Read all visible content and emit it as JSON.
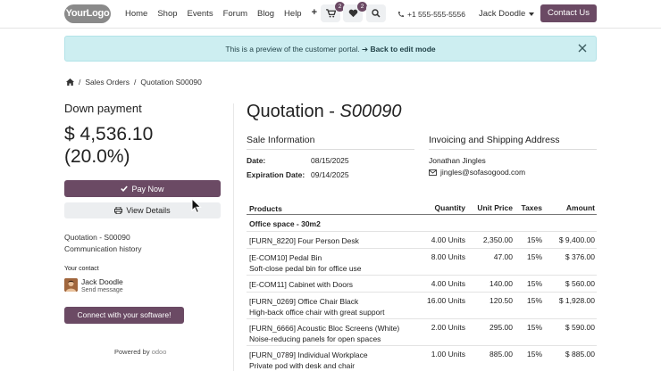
{
  "header": {
    "logo_text": "YourLogo",
    "nav": [
      "Home",
      "Shop",
      "Events",
      "Forum",
      "Blog",
      "Help"
    ],
    "cart_count": "2",
    "wishlist_count": "2",
    "phone": "+1 555-555-5556",
    "user_name": "Jack Doodle",
    "contact_label": "Contact Us"
  },
  "banner": {
    "text": "This is a preview of the customer portal.",
    "link": "Back to edit mode"
  },
  "breadcrumb": {
    "sales_orders": "Sales Orders",
    "current": "Quotation S00090"
  },
  "sidebar": {
    "down_payment_label": "Down payment",
    "amount": "$ 4,536.10",
    "percent": "(20.0%)",
    "pay_now": "Pay Now",
    "view_details": "View Details",
    "link_quotation": "Quotation - S00090",
    "link_history": "Communication history",
    "your_contact_label": "Your contact",
    "contact_name": "Jack Doodle",
    "send_message": "Send message",
    "connect_label": "Connect with your software!",
    "powered_by": "Powered by",
    "powered_brand": "odoo"
  },
  "quotation": {
    "title_prefix": "Quotation - ",
    "title_number": "S00090",
    "sale_info_title": "Sale Information",
    "date_label": "Date:",
    "date_value": "08/15/2025",
    "exp_label": "Expiration Date:",
    "exp_value": "09/14/2025",
    "invoicing_title": "Invoicing and Shipping Address",
    "customer_name": "Jonathan Jingles",
    "customer_email": "jingles@sofasogood.com"
  },
  "table": {
    "headers": {
      "products": "Products",
      "quantity": "Quantity",
      "unit_price": "Unit Price",
      "taxes": "Taxes",
      "amount": "Amount"
    },
    "section": "Office space - 30m2",
    "rows": [
      {
        "name": "[FURN_8220] Four Person Desk",
        "desc": "",
        "qty": "4.00 Units",
        "price": "2,350.00",
        "tax": "15%",
        "amount": "$ 9,400.00"
      },
      {
        "name": "[E-COM10] Pedal Bin",
        "desc": "Soft-close pedal bin for office use",
        "qty": "8.00 Units",
        "price": "47.00",
        "tax": "15%",
        "amount": "$ 376.00"
      },
      {
        "name": "[E-COM11] Cabinet with Doors",
        "desc": "",
        "qty": "4.00 Units",
        "price": "140.00",
        "tax": "15%",
        "amount": "$ 560.00"
      },
      {
        "name": "[FURN_0269] Office Chair Black",
        "desc": "High-back office chair with great support",
        "qty": "16.00 Units",
        "price": "120.50",
        "tax": "15%",
        "amount": "$ 1,928.00"
      },
      {
        "name": "[FURN_6666] Acoustic Bloc Screens (White)",
        "desc": "Noise-reducing panels for open spaces",
        "qty": "2.00 Units",
        "price": "295.00",
        "tax": "15%",
        "amount": "$ 590.00"
      },
      {
        "name": "[FURN_0789] Individual Workplace",
        "desc": "Private pod with desk and chair",
        "qty": "1.00 Units",
        "price": "885.00",
        "tax": "15%",
        "amount": "$ 885.00"
      }
    ]
  }
}
